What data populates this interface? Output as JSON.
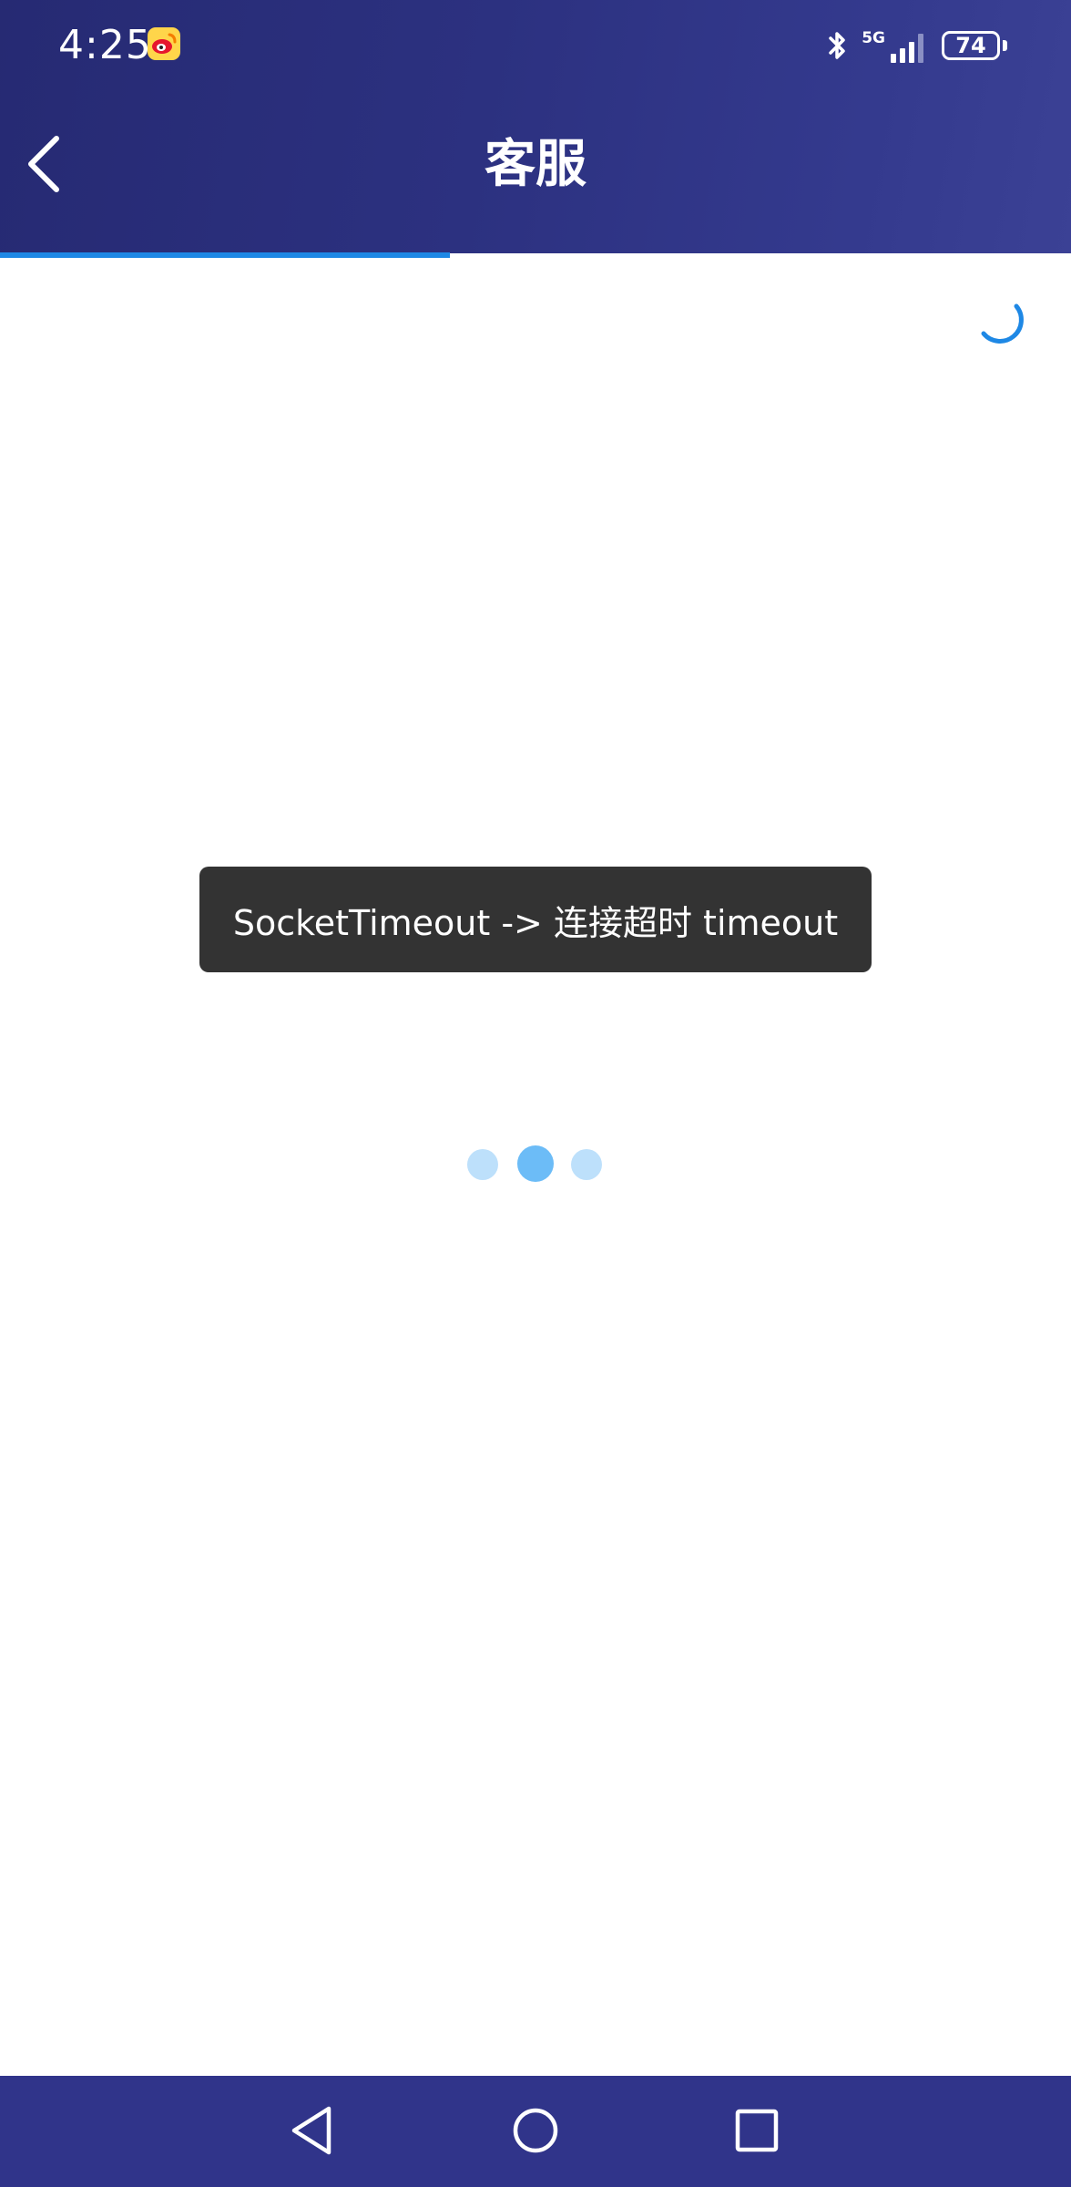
{
  "status_bar": {
    "time": "4:25",
    "network": "5G",
    "battery_level": "74",
    "notification_icons": [
      "weibo-icon"
    ],
    "system_icons": [
      "bluetooth-icon",
      "signal-icon",
      "battery-icon"
    ]
  },
  "header": {
    "title": "客服",
    "back_icon": "chevron-left-icon",
    "background_color": "#2c3180"
  },
  "page_load": {
    "progress_fraction": 0.42,
    "bar_color": "#1e88e5",
    "spinner_color": "#1e88e5"
  },
  "toast": {
    "message": "SocketTimeout -> 连接超时 timeout"
  },
  "loading_dots": {
    "count": 3,
    "active_index": 1,
    "active_color": "#6cbcf7",
    "inactive_color": "#bde0fb"
  },
  "nav_bar": {
    "buttons": [
      "back-triangle-icon",
      "home-circle-icon",
      "recents-square-icon"
    ],
    "background_color": "#30348a"
  }
}
